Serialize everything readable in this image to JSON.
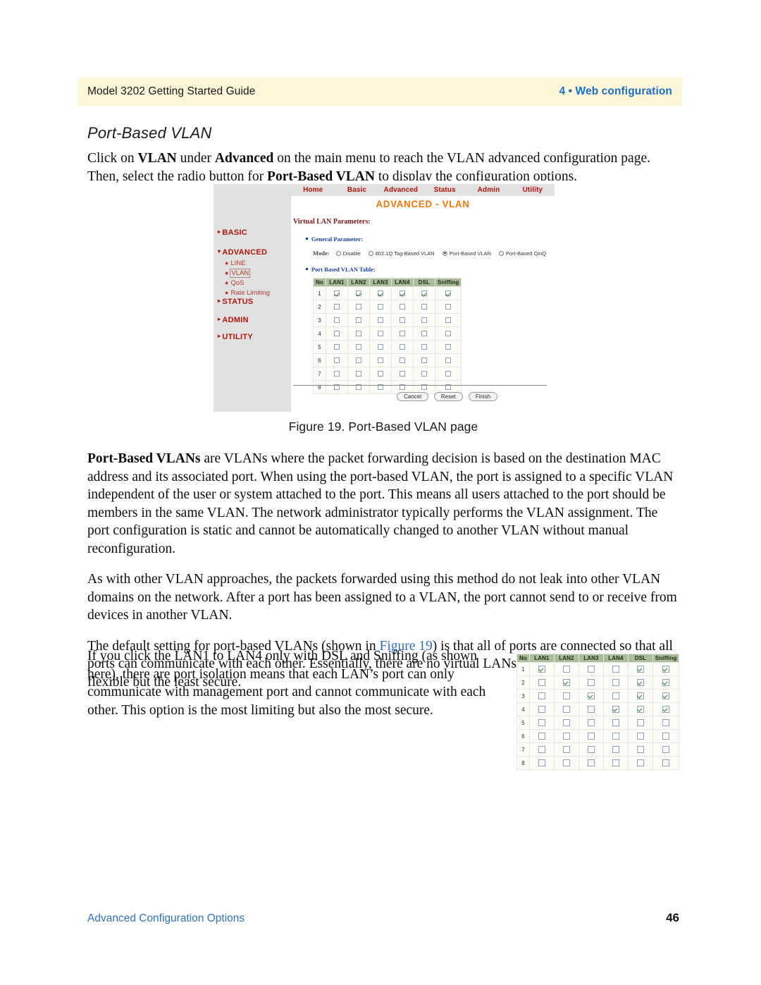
{
  "header": {
    "left": "Model 3202 Getting Started Guide",
    "right": "4 • Web configuration",
    "band_color": "#fdf6d8",
    "right_color": "#1a6fc4"
  },
  "section": {
    "title": "Port-Based VLAN",
    "intro": "Click on VLAN under Advanced on the main menu to reach the VLAN advanced configuration page. Then, select the radio button for Port-Based VLAN to display the configuration options.",
    "intro_parts": {
      "p1": "Click on ",
      "b1": "VLAN",
      "p2": " under ",
      "b2": "Advanced",
      "p3": " on the main menu to reach the VLAN advanced configuration page. Then, select the radio button for ",
      "b3": "Port-Based VLAN",
      "p4": " to display the configuration options."
    }
  },
  "figure": {
    "caption": "Figure 19. Port-Based VLAN page",
    "navbar": [
      "Home",
      "Basic",
      "Advanced",
      "Status",
      "Admin",
      "Utility"
    ],
    "page_title": "ADVANCED - VLAN",
    "nav_color": "#b01408",
    "title_color": "#f4760a",
    "sidebar": [
      {
        "label": "BASIC",
        "marker": "▸",
        "type": "group"
      },
      {
        "label": "ADVANCED",
        "marker": "▾",
        "type": "group"
      },
      {
        "label": "LINE",
        "type": "sub",
        "active": false
      },
      {
        "label": "VLAN",
        "type": "sub",
        "active": true
      },
      {
        "label": "QoS",
        "type": "sub",
        "active": false
      },
      {
        "label": "Rate Limiting",
        "type": "sub",
        "active": false
      },
      {
        "label": "STATUS",
        "marker": "▸",
        "type": "group"
      },
      {
        "label": "ADMIN",
        "marker": "▸",
        "type": "group"
      },
      {
        "label": "UTILITY",
        "marker": "▸",
        "type": "group"
      }
    ],
    "params_heading": "Virtual LAN Parameters:",
    "general_param_label": "General Parameter:",
    "mode_label": "Mode:",
    "mode_options": [
      {
        "label": "Disable",
        "selected": false
      },
      {
        "label": "802.1Q Tag-Based VLAN",
        "selected": false
      },
      {
        "label": "Port-Based VLAN",
        "selected": true
      },
      {
        "label": "Port-Based QinQ",
        "selected": false
      }
    ],
    "table_label": "Port Based VLAN Table:",
    "buttons": [
      "Cancel",
      "Reset",
      "Finish"
    ]
  },
  "vlan_table_default": {
    "columns": [
      "No",
      "LAN1",
      "LAN2",
      "LAN3",
      "LAN4",
      "DSL",
      "Sniffing"
    ],
    "rows": [
      {
        "no": "1",
        "checks": [
          true,
          true,
          true,
          true,
          true,
          true
        ]
      },
      {
        "no": "2",
        "checks": [
          false,
          false,
          false,
          false,
          false,
          false
        ]
      },
      {
        "no": "3",
        "checks": [
          false,
          false,
          false,
          false,
          false,
          false
        ]
      },
      {
        "no": "4",
        "checks": [
          false,
          false,
          false,
          false,
          false,
          false
        ]
      },
      {
        "no": "5",
        "checks": [
          false,
          false,
          false,
          false,
          false,
          false
        ]
      },
      {
        "no": "6",
        "checks": [
          false,
          false,
          false,
          false,
          false,
          false
        ]
      },
      {
        "no": "7",
        "checks": [
          false,
          false,
          false,
          false,
          false,
          false
        ]
      },
      {
        "no": "8",
        "checks": [
          false,
          false,
          false,
          false,
          false,
          false
        ]
      }
    ]
  },
  "vlan_table_isolated": {
    "columns": [
      "No",
      "LAN1",
      "LAN2",
      "LAN3",
      "LAN4",
      "DSL",
      "Sniffing"
    ],
    "rows": [
      {
        "no": "1",
        "checks": [
          true,
          false,
          false,
          false,
          true,
          true
        ]
      },
      {
        "no": "2",
        "checks": [
          false,
          true,
          false,
          false,
          true,
          true
        ]
      },
      {
        "no": "3",
        "checks": [
          false,
          false,
          true,
          false,
          true,
          true
        ]
      },
      {
        "no": "4",
        "checks": [
          false,
          false,
          false,
          true,
          true,
          true
        ]
      },
      {
        "no": "5",
        "checks": [
          false,
          false,
          false,
          false,
          false,
          false
        ]
      },
      {
        "no": "6",
        "checks": [
          false,
          false,
          false,
          false,
          false,
          false
        ]
      },
      {
        "no": "7",
        "checks": [
          false,
          false,
          false,
          false,
          false,
          false
        ]
      },
      {
        "no": "8",
        "checks": [
          false,
          false,
          false,
          false,
          false,
          false
        ]
      }
    ]
  },
  "body": {
    "para1_bold": "Port-Based VLANs",
    "para1_rest": " are VLANs where the packet forwarding decision is based on the destination MAC address and its associated port. When using the port-based VLAN, the port is assigned to a specific VLAN independent of the user or system attached to the port. This means all users attached to the port should be members in the same VLAN. The network administrator typically performs the VLAN assignment. The port configuration is static and cannot be automatically changed to another VLAN without manual reconfiguration.",
    "para2": "As with other VLAN approaches, the packets forwarded using this method do not leak into other VLAN domains on the network. After a port has been assigned to a VLAN, the port cannot send to or receive from devices in another VLAN.",
    "para3_a": "The default setting for port-based VLANs (shown in ",
    "para3_link": "Figure 19",
    "para3_b": ") is that all of ports are connected so that all ports can communicate with each other. Essentially, there are no virtual LANs. This option is the most flexible but the least secure.",
    "para4": "If you click the LAN1 to LAN4 only with DSL and Sniffing (as shown here), there are port isolation means that each LAN’s port can only communicate with management port and cannot communicate with each other. This option is the most limiting but also the most secure."
  },
  "footer": {
    "left": "Advanced Configuration Options",
    "page_number": "46"
  }
}
